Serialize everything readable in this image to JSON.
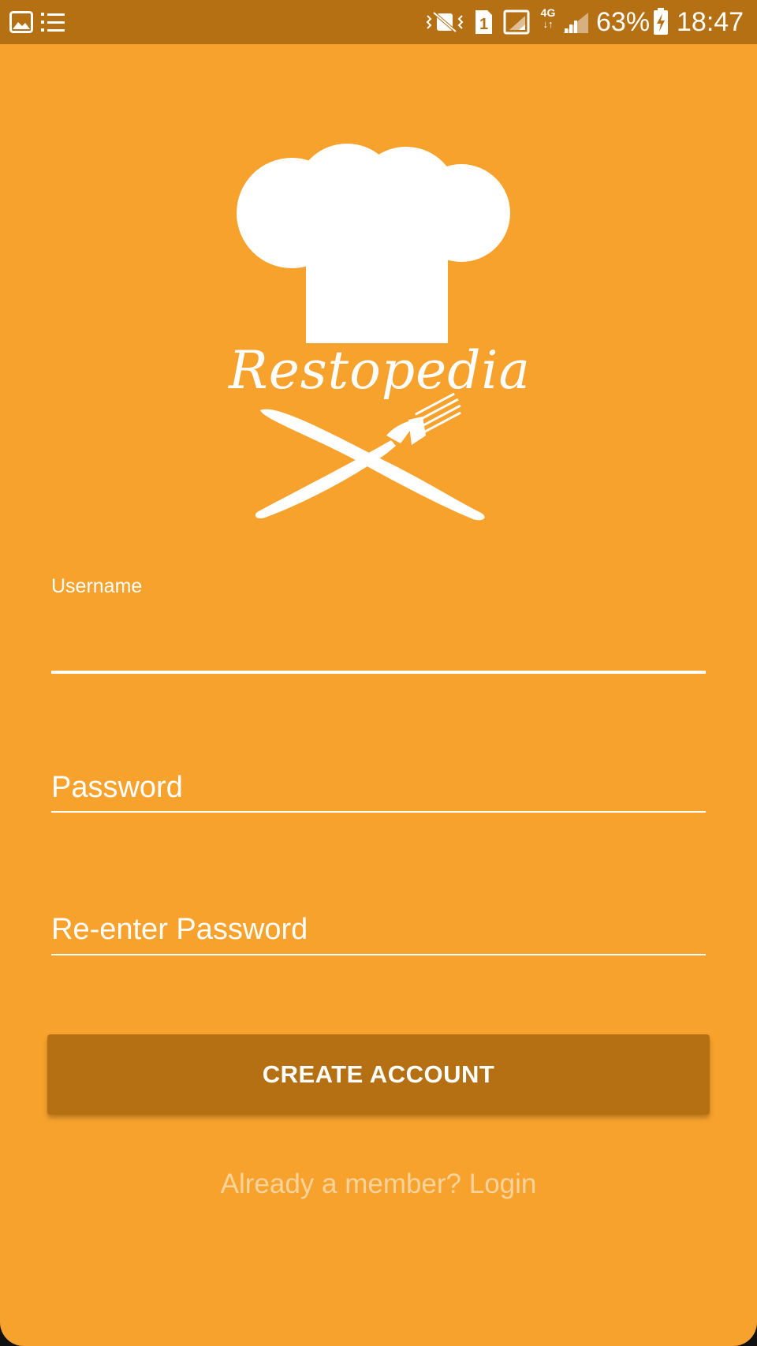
{
  "status_bar": {
    "icons": [
      "gallery-icon",
      "list-icon",
      "vibrate-icon",
      "sim-1-icon",
      "signal-icon",
      "4g-icon",
      "signal-icon",
      "battery-charging-icon"
    ],
    "sim_number": "1",
    "network_type": "4G",
    "battery_percent": "63%",
    "time": "18:47"
  },
  "logo": {
    "brand_name": "Restopedia",
    "icons": [
      "chef-hat-icon",
      "knife-icon",
      "fork-icon"
    ]
  },
  "form": {
    "username": {
      "label": "Username",
      "value": ""
    },
    "password": {
      "placeholder": "Password",
      "value": ""
    },
    "reenter_password": {
      "placeholder": "Re-enter Password",
      "value": ""
    },
    "submit_label": "CREATE ACCOUNT",
    "login_link": "Already a member? Login"
  },
  "colors": {
    "background": "#F7A22D",
    "status_bar": "#B57014",
    "button": "#B57014",
    "text": "#FFFFFF",
    "link": "#FBD39B"
  }
}
